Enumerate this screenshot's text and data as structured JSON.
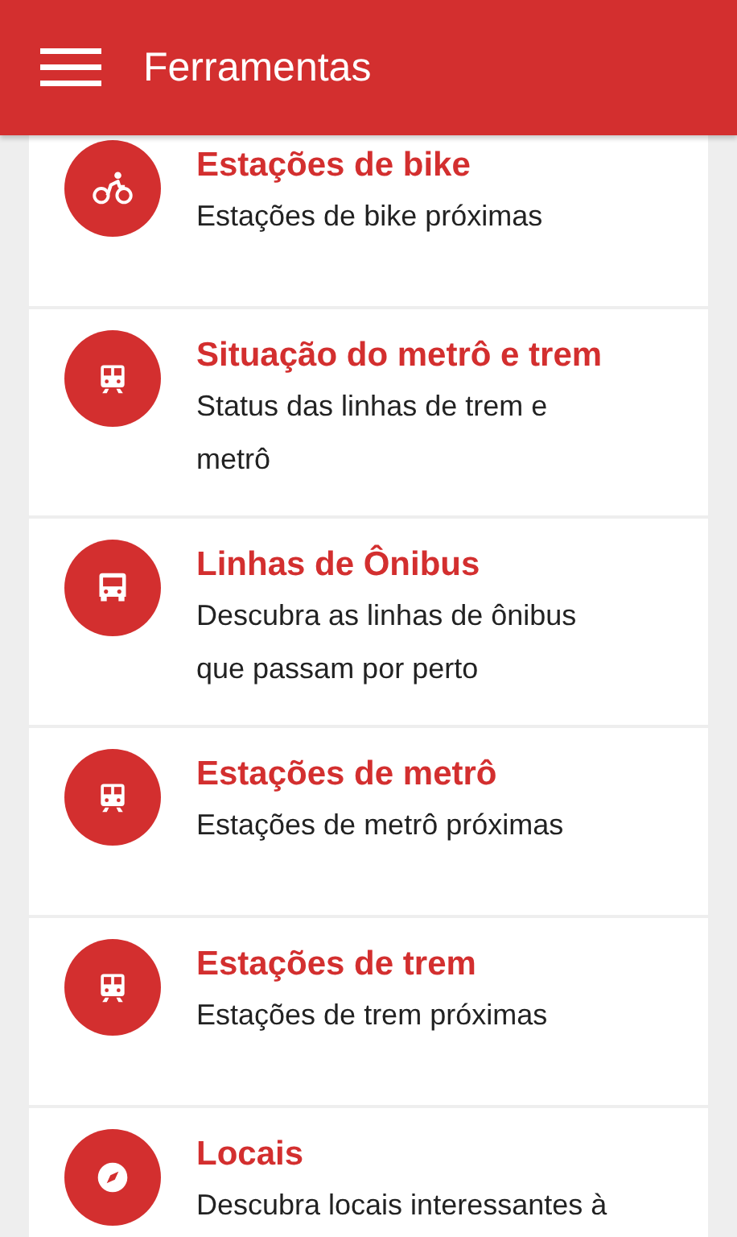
{
  "app_bar": {
    "title": "Ferramentas"
  },
  "items": [
    {
      "kind": "bike",
      "title": "Estações de bike",
      "subtitle": "Estações de bike próximas"
    },
    {
      "kind": "train",
      "title": "Situação do metrô e trem",
      "subtitle": "Status das linhas de trem e metrô"
    },
    {
      "kind": "bus",
      "title": "Linhas de Ônibus",
      "subtitle": "Descubra as linhas de ônibus que passam por perto"
    },
    {
      "kind": "train",
      "title": "Estações de metrô",
      "subtitle": "Estações de metrô próximas"
    },
    {
      "kind": "train",
      "title": "Estações de trem",
      "subtitle": "Estações de trem próximas"
    },
    {
      "kind": "compass",
      "title": "Locais",
      "subtitle": "Descubra locais interessantes à"
    }
  ]
}
